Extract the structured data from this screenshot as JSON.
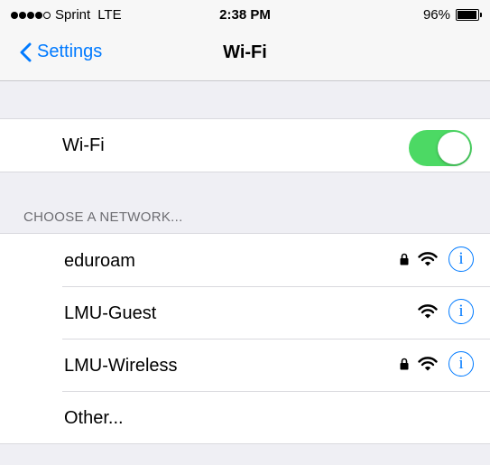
{
  "status_bar": {
    "carrier": "Sprint",
    "network": "LTE",
    "time": "2:38 PM",
    "battery": "96%",
    "battery_level": 0.96,
    "signal_bars": 4,
    "signal_max": 5
  },
  "nav": {
    "back_label": "Settings",
    "title": "Wi-Fi"
  },
  "wifi_toggle": {
    "label": "Wi-Fi",
    "on": true,
    "on_color": "#4cd964"
  },
  "section_header": "CHOOSE A NETWORK...",
  "networks": [
    {
      "name": "eduroam",
      "secured": true,
      "signal_icon": "wifi-icon",
      "info_icon": "info-icon",
      "info_glyph": "i"
    },
    {
      "name": "LMU-Guest",
      "secured": false,
      "signal_icon": "wifi-icon",
      "info_icon": "info-icon",
      "info_glyph": "i"
    },
    {
      "name": "LMU-Wireless",
      "secured": true,
      "signal_icon": "wifi-icon",
      "info_icon": "info-icon",
      "info_glyph": "i"
    },
    {
      "name": "Other..."
    }
  ],
  "colors": {
    "accent": "#007aff",
    "background": "#efeff4"
  }
}
